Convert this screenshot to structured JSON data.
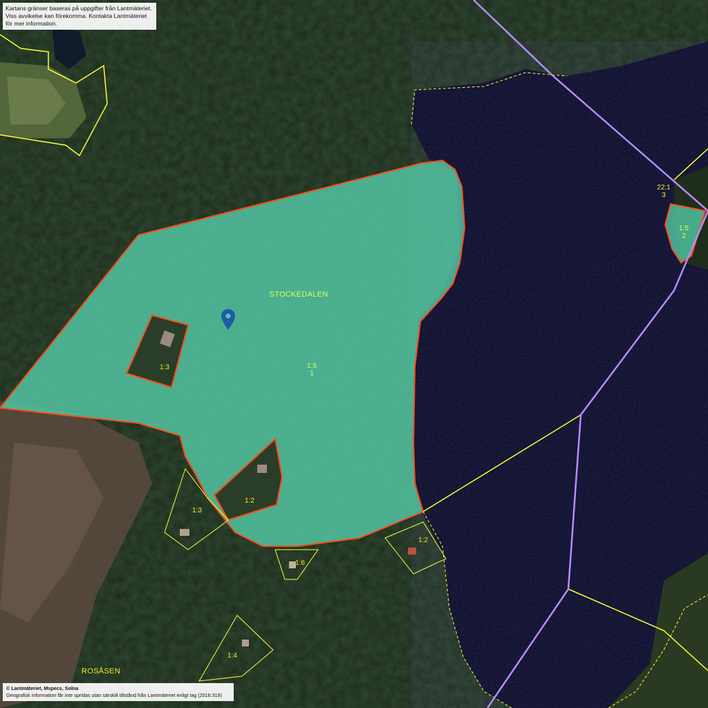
{
  "notice": {
    "line1": "Kartans gränser baseras på uppgifter från Lantmäteriet.",
    "line2": "Viss avvikelse kan förekomma. Kontakta Lantmäteriet för mer information."
  },
  "copyright": {
    "line1": "© Lantmäteriet, Mspecs, Solna",
    "line2": "Geografisk information får inte spridas utan särskilt tillstånd från Lantmäteriet enligt lag (2016:319)"
  },
  "place_names": {
    "stockedalen": "STOCKEDALEN",
    "rosasen": "ROSÅSEN"
  },
  "parcels": {
    "main_designation": "1:5",
    "main_sub": "1",
    "enclave_west": "1:3",
    "enclave_south": "1:2",
    "southwest": "1:3",
    "south_small": "1:6",
    "southeast": "1:2",
    "far_south": "1:4",
    "lake_id": "22:1",
    "lake_sub": "3",
    "island_designation": "1:5",
    "island_sub": "2"
  },
  "icons": {
    "marker": "location-pin-icon"
  },
  "colors": {
    "parcel_fill": "#54c9a6",
    "parcel_border": "#ff4a1a",
    "property_line": "#ffff33",
    "municipal_line": "#b78cff",
    "marker": "#1f5aa8",
    "water": "#0d0d2b"
  }
}
